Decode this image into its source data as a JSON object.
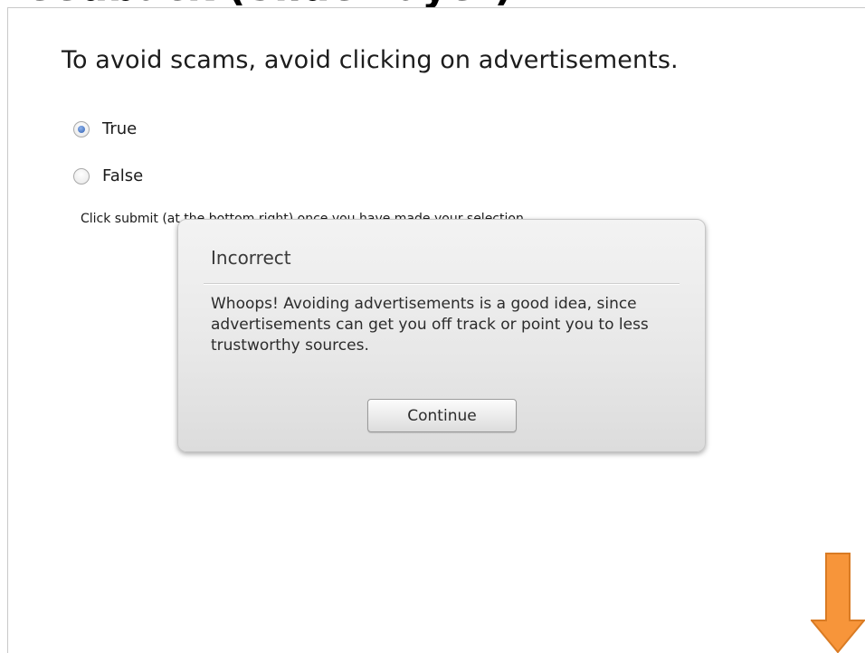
{
  "page": {
    "title": "Feedback (Slide Layer)"
  },
  "quiz": {
    "question": "To avoid scams, avoid clicking on advertisements.",
    "options": [
      {
        "label": "True",
        "selected": true
      },
      {
        "label": "False",
        "selected": false
      }
    ],
    "instruction": "Click submit (at the bottom right) once you have made your selection."
  },
  "feedback": {
    "title": "Incorrect",
    "message": "Whoops! Avoiding advertisements is a good idea, since advertisements can get you off track or point you to less trustworthy sources.",
    "continue_label": "Continue"
  },
  "icons": {
    "arrow": "down-arrow-icon"
  },
  "colors": {
    "arrow_fill": "#F7953A",
    "arrow_stroke": "#D97B24",
    "radio_selected": "#2F5FB4"
  }
}
